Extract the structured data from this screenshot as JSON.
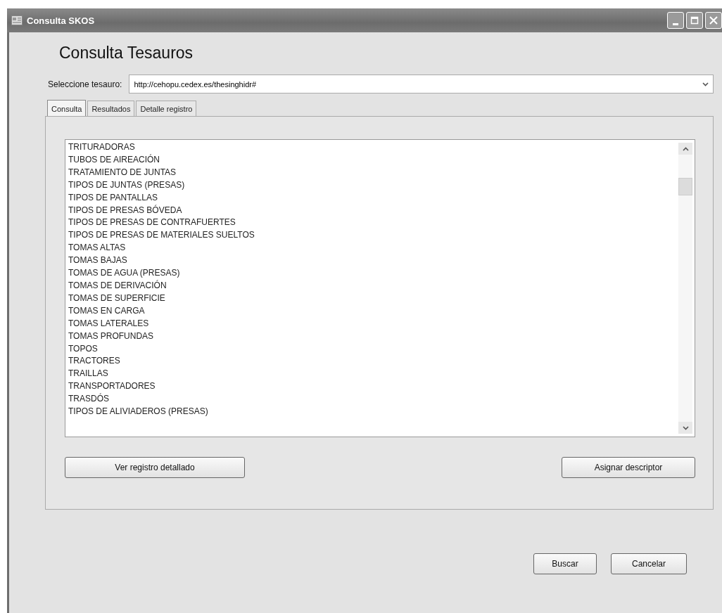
{
  "window": {
    "title": "Consulta SKOS"
  },
  "heading": "Consulta Tesauros",
  "thesaurus": {
    "label": "Seleccione tesauro:",
    "value": "http://cehopu.cedex.es/thesinghidr#"
  },
  "tabs": [
    {
      "label": "Consulta",
      "selected": true
    },
    {
      "label": "Resultados",
      "selected": false
    },
    {
      "label": "Detalle registro",
      "selected": false
    }
  ],
  "terms": [
    "TRITURADORAS",
    "TUBOS DE AIREACIÓN",
    "TRATAMIENTO DE JUNTAS",
    "TIPOS DE JUNTAS (PRESAS)",
    "TIPOS DE PANTALLAS",
    "TIPOS DE PRESAS BÓVEDA",
    "TIPOS DE PRESAS DE CONTRAFUERTES",
    "TIPOS DE PRESAS DE MATERIALES SUELTOS",
    "TOMAS ALTAS",
    "TOMAS BAJAS",
    "TOMAS DE AGUA (PRESAS)",
    "TOMAS DE DERIVACIÓN",
    "TOMAS DE SUPERFICIE",
    "TOMAS EN CARGA",
    "TOMAS LATERALES",
    "TOMAS PROFUNDAS",
    "TOPOS",
    "TRACTORES",
    "TRAILLAS",
    "TRANSPORTADORES",
    "TRASDÓS",
    "TIPOS DE ALIVIADEROS (PRESAS)"
  ],
  "panel_buttons": [
    "Ver registro detallado",
    "Asignar descriptor"
  ],
  "buttons": [
    "Buscar",
    "Cancelar"
  ]
}
